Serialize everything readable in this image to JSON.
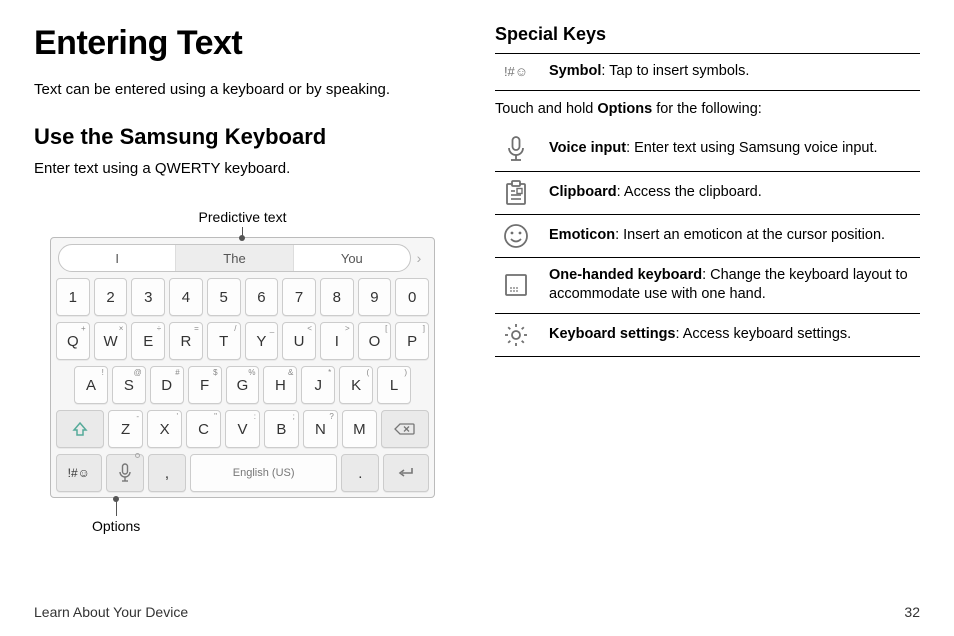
{
  "page": {
    "title": "Entering Text",
    "intro": "Text can be entered using a keyboard or by speaking.",
    "footer_left": "Learn About Your Device",
    "page_number": "32"
  },
  "left": {
    "heading": "Use the Samsung Keyboard",
    "subtext": "Enter text using a QWERTY keyboard.",
    "predictive_label": "Predictive text",
    "options_label": "Options",
    "predictions": [
      "I",
      "The",
      "You"
    ],
    "pred_arrow": "›",
    "num_row": [
      "1",
      "2",
      "3",
      "4",
      "5",
      "6",
      "7",
      "8",
      "9",
      "0"
    ],
    "qwerty_row": {
      "letters": [
        "Q",
        "W",
        "E",
        "R",
        "T",
        "Y",
        "U",
        "I",
        "O",
        "P"
      ],
      "supers": [
        "+",
        "×",
        "÷",
        "=",
        "/",
        "_",
        "<",
        ">",
        "[",
        "]"
      ]
    },
    "asdf_row": {
      "letters": [
        "A",
        "S",
        "D",
        "F",
        "G",
        "H",
        "J",
        "K",
        "L"
      ],
      "supers": [
        "!",
        "@",
        "#",
        "$",
        "%",
        "&",
        "*",
        "(",
        ")"
      ]
    },
    "zxcv_row": {
      "letters": [
        "Z",
        "X",
        "C",
        "V",
        "B",
        "N",
        "M"
      ],
      "supers": [
        "-",
        "'",
        "\"",
        ":",
        ";",
        "?",
        ""
      ]
    },
    "bottom_row": {
      "sym": "!#☺",
      "comma": ",",
      "space": "English (US)",
      "period": "."
    }
  },
  "right": {
    "heading": "Special Keys",
    "symbol_label": "!#☺",
    "symbol_bold": "Symbol",
    "symbol_text": ": Tap to insert symbols.",
    "between_pre": "Touch and hold ",
    "between_bold": "Options",
    "between_post": " for the following:",
    "rows": [
      {
        "icon": "mic-icon",
        "bold": "Voice input",
        "text": ": Enter text using Samsung voice input."
      },
      {
        "icon": "clipboard-icon",
        "bold": "Clipboard",
        "text": ": Access the clipboard."
      },
      {
        "icon": "emoticon-icon",
        "bold": "Emoticon",
        "text": ": Insert an emoticon at the cursor position."
      },
      {
        "icon": "one-handed-icon",
        "bold": "One-handed keyboard",
        "text": ": Change the keyboard layout to accommodate use with one hand."
      },
      {
        "icon": "gear-icon",
        "bold": "Keyboard settings",
        "text": ": Access keyboard settings."
      }
    ]
  }
}
